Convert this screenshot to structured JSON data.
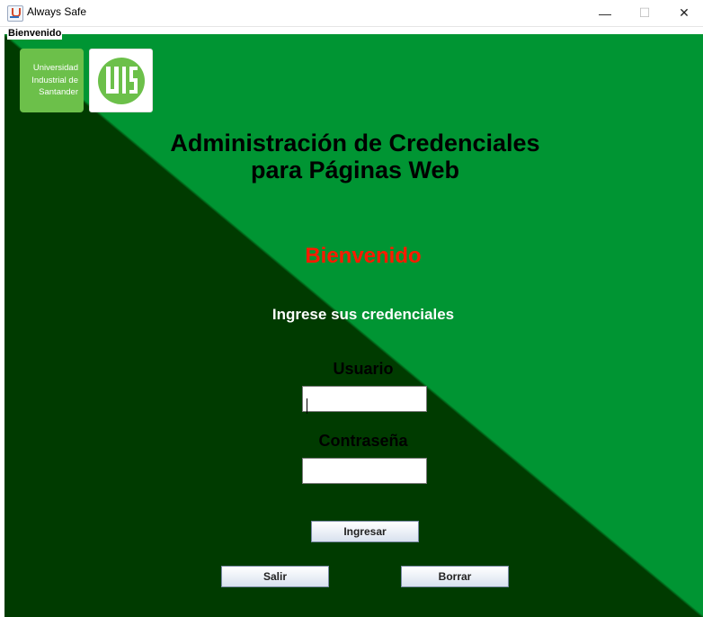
{
  "window": {
    "title": "Always Safe",
    "icon": "java-cup-icon",
    "controls": {
      "minimize": "—",
      "maximize": "☐",
      "close": "✕"
    }
  },
  "panel": {
    "border_title": "Bienvenido",
    "colors": {
      "dark_green": "#003b00",
      "light_green": "#009533"
    }
  },
  "logos": {
    "university_lines": [
      "Universidad",
      "Industrial de",
      "Santander"
    ],
    "seal_text": "UIS",
    "colors": {
      "logo_green": "#6cc04a"
    }
  },
  "header": {
    "title_line1": "Administración de Credenciales",
    "title_line2": "para Páginas Web"
  },
  "welcome": {
    "text": "Bienvenido",
    "color": "#ff1a00"
  },
  "prompt": {
    "text": "Ingrese sus credenciales"
  },
  "form": {
    "username": {
      "label": "Usuario",
      "value": ""
    },
    "password": {
      "label": "Contraseña",
      "value": ""
    }
  },
  "buttons": {
    "login": "Ingresar",
    "exit": "Salir",
    "clear": "Borrar"
  }
}
